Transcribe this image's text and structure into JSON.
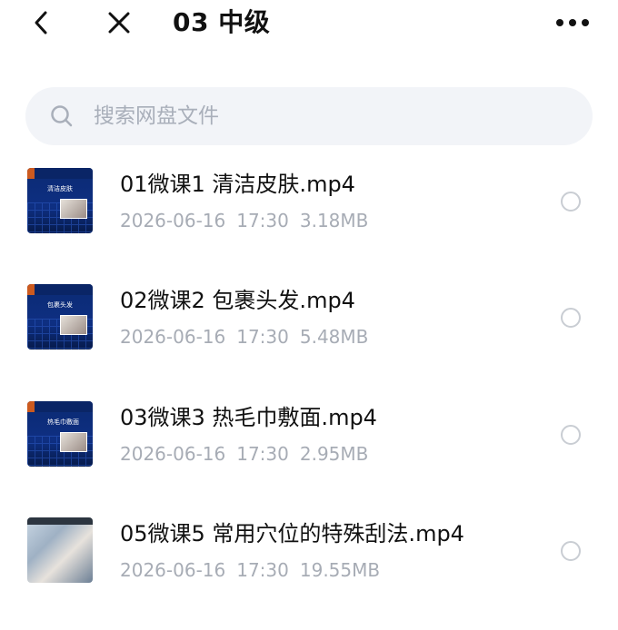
{
  "header": {
    "title": "03 中级",
    "back_icon": "chevron-left-icon",
    "close_icon": "close-icon",
    "more_icon": "more-dots-icon"
  },
  "search": {
    "placeholder": "搜索网盘文件",
    "icon": "search-icon"
  },
  "files": [
    {
      "name": "01微课1 清洁皮肤.mp4",
      "date": "2026-06-16",
      "time": "17:30",
      "size": "3.18MB",
      "thumb_label": "清洁皮肤"
    },
    {
      "name": "02微课2 包裹头发.mp4",
      "date": "2026-06-16",
      "time": "17:30",
      "size": "5.48MB",
      "thumb_label": "包裹头发"
    },
    {
      "name": "03微课3 热毛巾敷面.mp4",
      "date": "2026-06-16",
      "time": "17:30",
      "size": "2.95MB",
      "thumb_label": "热毛巾敷面"
    },
    {
      "name": "05微课5 常用穴位的特殊刮法.mp4",
      "date": "2026-06-16",
      "time": "17:30",
      "size": "19.55MB"
    }
  ],
  "colors": {
    "search_bg": "#f2f4f8",
    "meta_text": "#a7acb5",
    "radio_border": "#c9cdd3"
  }
}
